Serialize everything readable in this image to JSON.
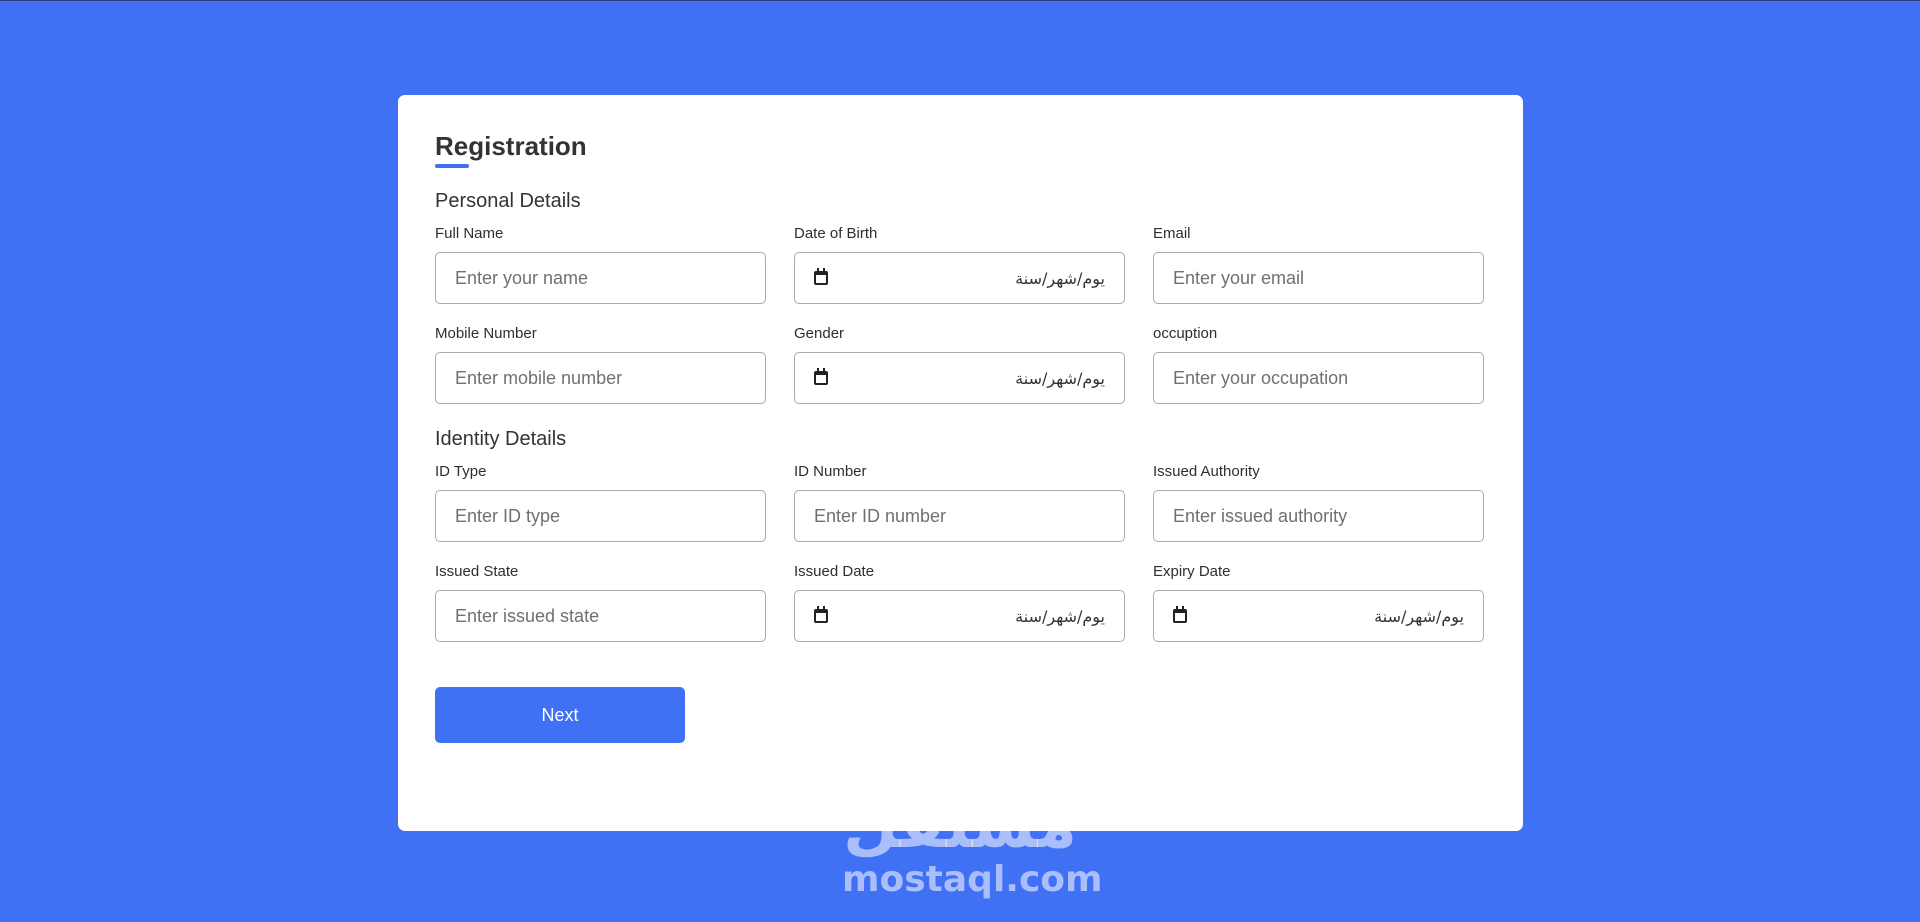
{
  "form": {
    "title": "Registration",
    "accent_color": "#4070f4",
    "sections": [
      {
        "title": "Personal Details",
        "fields": [
          {
            "label": "Full Name",
            "placeholder": "Enter your name",
            "type": "text"
          },
          {
            "label": "Date of Birth",
            "value": "يوم/شهر/سنة",
            "type": "date"
          },
          {
            "label": "Email",
            "placeholder": "Enter your email",
            "type": "text"
          },
          {
            "label": "Mobile Number",
            "placeholder": "Enter mobile number",
            "type": "text"
          },
          {
            "label": "Gender",
            "value": "يوم/شهر/سنة",
            "type": "date"
          },
          {
            "label": "occuption",
            "placeholder": "Enter your occupation",
            "type": "text"
          }
        ]
      },
      {
        "title": "Identity Details",
        "fields": [
          {
            "label": "ID Type",
            "placeholder": "Enter ID type",
            "type": "text"
          },
          {
            "label": "ID Number",
            "placeholder": "Enter ID number",
            "type": "text"
          },
          {
            "label": "Issued Authority",
            "placeholder": "Enter issued authority",
            "type": "text"
          },
          {
            "label": "Issued State",
            "placeholder": "Enter issued state",
            "type": "text"
          },
          {
            "label": "Issued Date",
            "value": "يوم/شهر/سنة",
            "type": "date"
          },
          {
            "label": "Expiry Date",
            "value": "يوم/شهر/سنة",
            "type": "date"
          }
        ]
      }
    ],
    "next_label": "Next",
    "calendar_icon": "calendar-icon"
  },
  "watermark": {
    "arabic": "مستقل",
    "latin": "mostaql.com"
  }
}
